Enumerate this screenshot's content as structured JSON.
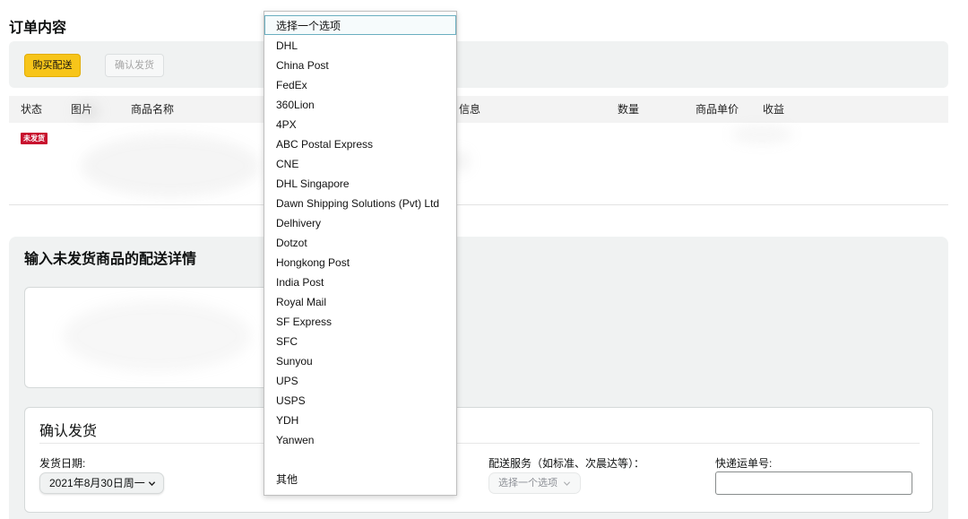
{
  "page": {
    "title": "订单内容"
  },
  "toolbar": {
    "buy_shipping_label": "购买配送",
    "confirm_shipment_label": "确认发货"
  },
  "colors": {
    "accent": "#f7c51a",
    "status_badge": "#c8102e",
    "selection_border": "#6aaec0"
  },
  "table": {
    "headers": [
      "状态",
      "图片",
      "商品名称",
      "信息",
      "数量",
      "商品单价",
      "收益"
    ],
    "rows": [
      {
        "status": "未发货"
      }
    ]
  },
  "shipping_details": {
    "title": "输入未发货商品的配送详情"
  },
  "confirm_card": {
    "title": "确认发货",
    "ship_date_label": "发货日期:",
    "ship_date_value": "2021年8月30日周一",
    "service_label": "配送服务（如标准、次晨达等）：",
    "service_value": "选择一个选项",
    "tracking_label": "快递运单号:",
    "tracking_value": ""
  },
  "carrier_dropdown": {
    "selected_index": 0,
    "options": [
      "选择一个选项",
      "DHL",
      "China Post",
      "FedEx",
      "360Lion",
      "4PX",
      "ABC Postal Express",
      "CNE",
      "DHL Singapore",
      "Dawn Shipping Solutions (Pvt) Ltd",
      "Delhivery",
      "Dotzot",
      "Hongkong Post",
      "India Post",
      "Royal Mail",
      "SF Express",
      "SFC",
      "Sunyou",
      "UPS",
      "USPS",
      "YDH",
      "Yanwen"
    ],
    "other_option": "其他"
  }
}
